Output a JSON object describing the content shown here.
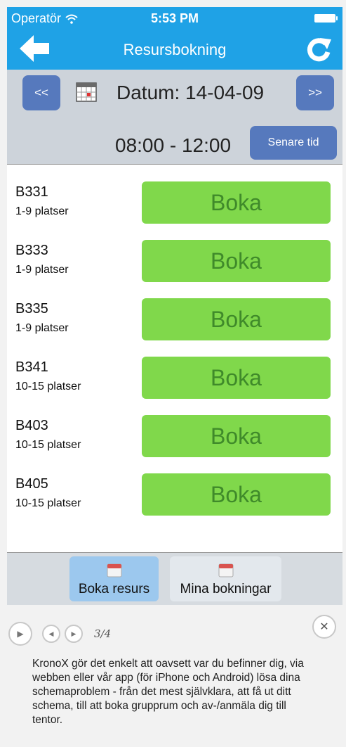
{
  "status_bar": {
    "carrier": "Operatör",
    "time": "5:53 PM"
  },
  "nav": {
    "title": "Resursbokning"
  },
  "date_bar": {
    "prev_label": "<<",
    "next_label": ">>",
    "date_label": "Datum: 14-04-09",
    "time_range": "08:00 - 12:00",
    "later_label": "Senare tid"
  },
  "rooms": [
    {
      "name": "B331",
      "capacity": "1-9 platser",
      "action": "Boka"
    },
    {
      "name": "B333",
      "capacity": "1-9 platser",
      "action": "Boka"
    },
    {
      "name": "B335",
      "capacity": "1-9 platser",
      "action": "Boka"
    },
    {
      "name": "B341",
      "capacity": "10-15 platser",
      "action": "Boka"
    },
    {
      "name": "B403",
      "capacity": "10-15 platser",
      "action": "Boka"
    },
    {
      "name": "B405",
      "capacity": "10-15 platser",
      "action": "Boka"
    }
  ],
  "tabs": {
    "book": "Boka resurs",
    "mine": "Mina bokningar"
  },
  "slideshow": {
    "counter": "3/4",
    "caption": "KronoX gör det enkelt att oavsett var du befinner dig, via webben eller vår app (för iPhone och Android) lösa dina schemaproblem - från det mest självklara, att få ut ditt schema, till att boka grupprum och av-/anmäla dig till tentor."
  },
  "colors": {
    "header_blue": "#1fa2e6",
    "button_blue": "#5679bd",
    "book_green": "#80d84b",
    "book_text": "#3f8a2a"
  },
  "icons": [
    "wifi-icon",
    "back-arrow-icon",
    "refresh-icon",
    "calendar-icon",
    "play-icon",
    "prev-icon",
    "next-icon",
    "close-icon"
  ]
}
